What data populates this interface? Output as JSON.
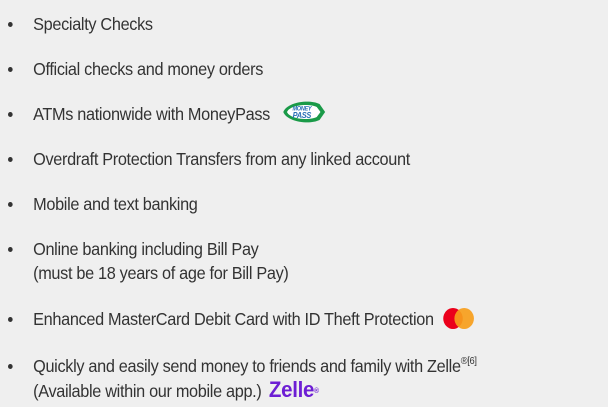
{
  "features": [
    {
      "lines": [
        "Specialty Checks"
      ]
    },
    {
      "lines": [
        "Official checks and money orders"
      ]
    },
    {
      "lines": [
        "ATMs nationwide with MoneyPass"
      ],
      "logo": "moneypass-logo",
      "logo_text": [
        "MONEY",
        "PASS"
      ]
    },
    {
      "lines": [
        "Overdraft Protection Transfers from any linked account"
      ]
    },
    {
      "lines": [
        "Mobile and text banking"
      ]
    },
    {
      "lines": [
        "Online banking including Bill Pay",
        "(must be 18 years of age for Bill Pay)"
      ]
    },
    {
      "lines": [
        "Enhanced MasterCard Debit Card with ID Theft Protection"
      ],
      "logo": "mastercard-logo"
    },
    {
      "lines": [
        "Quickly and easily send money to friends and family with Zelle",
        "(Available within our mobile app.)"
      ],
      "superscript": "®[6]",
      "logo": "zelle-logo",
      "logo_text": "Zelle",
      "logo_mark": "®"
    }
  ],
  "colors": {
    "background": "#efefef",
    "text": "#333333",
    "moneypass_green": "#1a9a48",
    "moneypass_blue": "#2a6fb6",
    "mastercard_red": "#eb001b",
    "mastercard_orange": "#f79e1b",
    "zelle_purple": "#6d1ed4"
  }
}
